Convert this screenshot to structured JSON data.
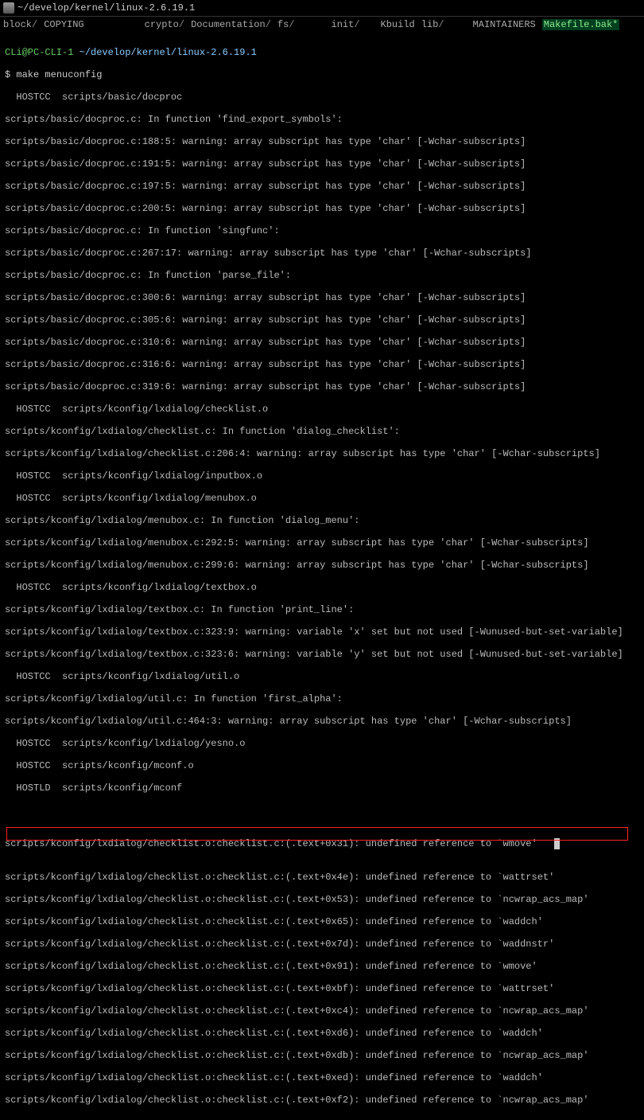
{
  "titlebar": {
    "path": " ~/develop/kernel/linux-2.6.19.1"
  },
  "tabs": {
    "t1": "block",
    "t2": "COPYING",
    "t3": "crypto",
    "t4": "Documentation",
    "t5": "fs",
    "t6": "init",
    "t7": "Kbuild",
    "t8": "lib",
    "t9": "MAINTAINERS",
    "t10": "Makefile.bak*"
  },
  "prompt": {
    "user": "CLi@PC-CLI-1 ",
    "path": "~/develop/kernel/linux-2.6.19.1",
    "dollar": "$ ",
    "command": "make menuconfig"
  },
  "lines": {
    "l0": "  HOSTCC  scripts/basic/docproc",
    "l1": "scripts/basic/docproc.c: In function 'find_export_symbols':",
    "l2": "scripts/basic/docproc.c:188:5: warning: array subscript has type 'char' [-Wchar-subscripts]",
    "l3": "scripts/basic/docproc.c:191:5: warning: array subscript has type 'char' [-Wchar-subscripts]",
    "l4": "scripts/basic/docproc.c:197:5: warning: array subscript has type 'char' [-Wchar-subscripts]",
    "l5": "scripts/basic/docproc.c:200:5: warning: array subscript has type 'char' [-Wchar-subscripts]",
    "l6": "scripts/basic/docproc.c: In function 'singfunc':",
    "l7": "scripts/basic/docproc.c:267:17: warning: array subscript has type 'char' [-Wchar-subscripts]",
    "l8": "scripts/basic/docproc.c: In function 'parse_file':",
    "l9": "scripts/basic/docproc.c:300:6: warning: array subscript has type 'char' [-Wchar-subscripts]",
    "l10": "scripts/basic/docproc.c:305:6: warning: array subscript has type 'char' [-Wchar-subscripts]",
    "l11": "scripts/basic/docproc.c:310:6: warning: array subscript has type 'char' [-Wchar-subscripts]",
    "l12": "scripts/basic/docproc.c:316:6: warning: array subscript has type 'char' [-Wchar-subscripts]",
    "l13": "scripts/basic/docproc.c:319:6: warning: array subscript has type 'char' [-Wchar-subscripts]",
    "l14": "  HOSTCC  scripts/kconfig/lxdialog/checklist.o",
    "l15": "scripts/kconfig/lxdialog/checklist.c: In function 'dialog_checklist':",
    "l16": "scripts/kconfig/lxdialog/checklist.c:206:4: warning: array subscript has type 'char' [-Wchar-subscripts]",
    "l17": "  HOSTCC  scripts/kconfig/lxdialog/inputbox.o",
    "l18": "  HOSTCC  scripts/kconfig/lxdialog/menubox.o",
    "l19": "scripts/kconfig/lxdialog/menubox.c: In function 'dialog_menu':",
    "l20": "scripts/kconfig/lxdialog/menubox.c:292:5: warning: array subscript has type 'char' [-Wchar-subscripts]",
    "l21": "scripts/kconfig/lxdialog/menubox.c:299:6: warning: array subscript has type 'char' [-Wchar-subscripts]",
    "l22": "  HOSTCC  scripts/kconfig/lxdialog/textbox.o",
    "l23": "scripts/kconfig/lxdialog/textbox.c: In function 'print_line':",
    "l24": "scripts/kconfig/lxdialog/textbox.c:323:9: warning: variable 'x' set but not used [-Wunused-but-set-variable]",
    "l25": "scripts/kconfig/lxdialog/textbox.c:323:6: warning: variable 'y' set but not used [-Wunused-but-set-variable]",
    "l26": "  HOSTCC  scripts/kconfig/lxdialog/util.o",
    "l27": "scripts/kconfig/lxdialog/util.c: In function 'first_alpha':",
    "l28": "scripts/kconfig/lxdialog/util.c:464:3: warning: array subscript has type 'char' [-Wchar-subscripts]",
    "l29": "  HOSTCC  scripts/kconfig/lxdialog/yesno.o",
    "l30": "  HOSTCC  scripts/kconfig/mconf.o",
    "l31": "  HOSTLD  scripts/kconfig/mconf",
    "l32": "scripts/kconfig/lxdialog/checklist.o:checklist.c:(.text+0x31): undefined reference to `wmove'",
    "l33": "scripts/kconfig/lxdialog/checklist.o:checklist.c:(.text+0x4e): undefined reference to `wattrset'",
    "l34": "scripts/kconfig/lxdialog/checklist.o:checklist.c:(.text+0x53): undefined reference to `ncwrap_acs_map'",
    "l35": "scripts/kconfig/lxdialog/checklist.o:checklist.c:(.text+0x65): undefined reference to `waddch'",
    "l36": "scripts/kconfig/lxdialog/checklist.o:checklist.c:(.text+0x7d): undefined reference to `waddnstr'",
    "l37": "scripts/kconfig/lxdialog/checklist.o:checklist.c:(.text+0x91): undefined reference to `wmove'",
    "l38": "scripts/kconfig/lxdialog/checklist.o:checklist.c:(.text+0xbf): undefined reference to `wattrset'",
    "l39": "scripts/kconfig/lxdialog/checklist.o:checklist.c:(.text+0xc4): undefined reference to `ncwrap_acs_map'",
    "l40": "scripts/kconfig/lxdialog/checklist.o:checklist.c:(.text+0xd6): undefined reference to `waddch'",
    "l41": "scripts/kconfig/lxdialog/checklist.o:checklist.c:(.text+0xdb): undefined reference to `ncwrap_acs_map'",
    "l42": "scripts/kconfig/lxdialog/checklist.o:checklist.c:(.text+0xed): undefined reference to `waddch'",
    "l43": "scripts/kconfig/lxdialog/checklist.o:checklist.c:(.text+0xf2): undefined reference to `ncwrap_acs_map'"
  }
}
